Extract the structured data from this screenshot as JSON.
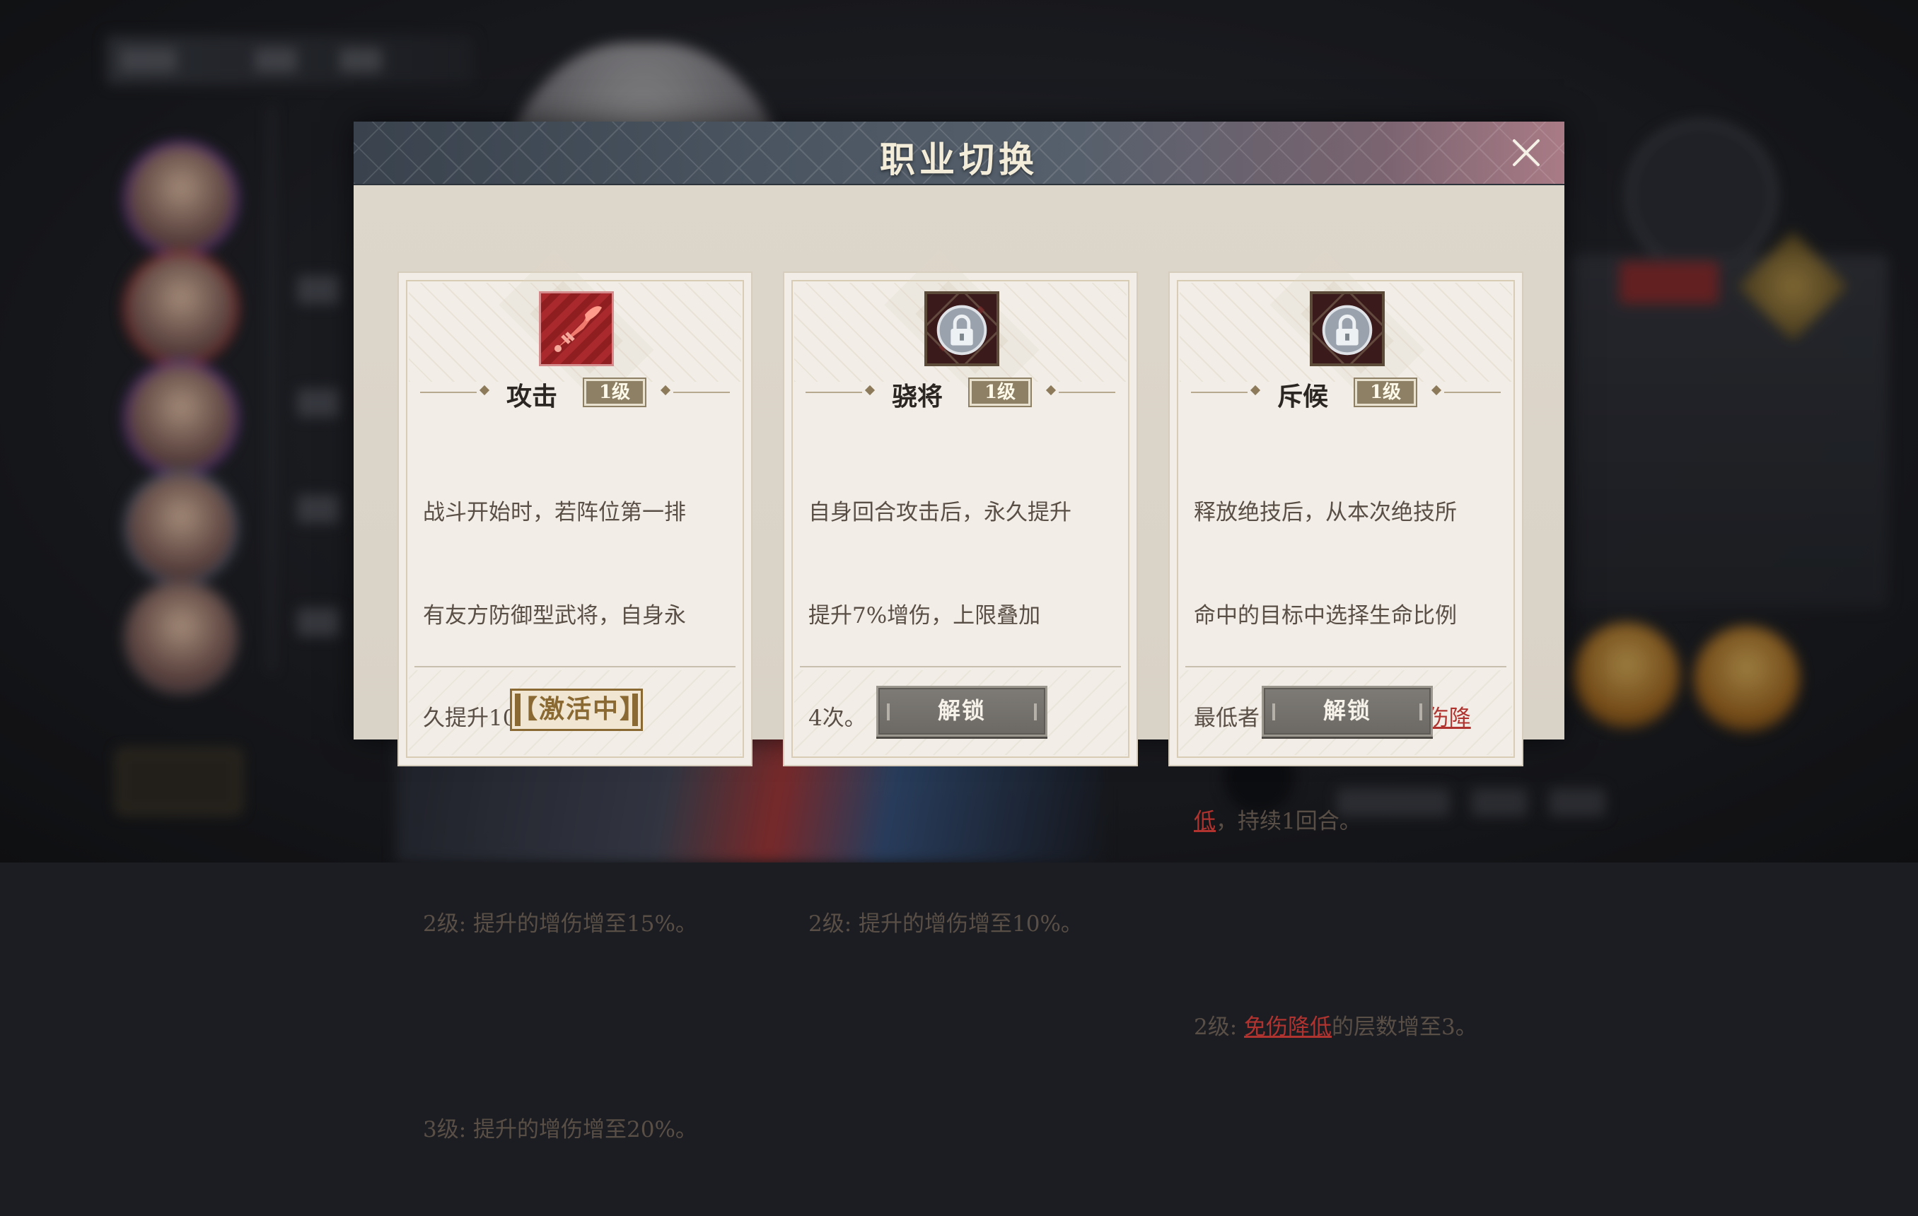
{
  "dialog": {
    "title": "职业切换",
    "close_icon": "close-icon"
  },
  "cards": [
    {
      "icon": "sword-icon",
      "name": "攻击",
      "level": "1级",
      "desc_lines": [
        "战斗开始时，若阵位第一排",
        "有友方防御型武将，自身永",
        "久提升10%增伤。"
      ],
      "level2": "2级: 提升的增伤增至15%。",
      "level3": "3级: 提升的增伤增至20%。",
      "status": "【激活中】",
      "status_state": "active"
    },
    {
      "icon": "lock-icon",
      "name": "骁将",
      "level": "1级",
      "desc_lines": [
        "自身回合攻击后，永久提升",
        "提升7%增伤，上限叠加",
        "4次。"
      ],
      "level2": "2级: 提升的增伤增至10%。",
      "button": "解锁",
      "status_state": "locked"
    },
    {
      "icon": "lock-icon",
      "name": "斥候",
      "level": "1级",
      "desc_line1": "释放绝技后，从本次绝技所",
      "desc_line2": "命中的目标中选择生命比例",
      "desc_line3_pre": "最低者，对其附加2层",
      "desc_line3_hl": "免伤降",
      "desc_line4_hl": "低",
      "desc_line4_post": "，持续1回合。",
      "level2_pre": "2级: ",
      "level2_hl": "免伤降低",
      "level2_post": "的层数增至3。",
      "button": "解锁",
      "status_state": "locked"
    }
  ],
  "colors": {
    "highlight": "#b0332f",
    "active_gold": "#8a6a32",
    "attack_red": "#9c2326"
  }
}
